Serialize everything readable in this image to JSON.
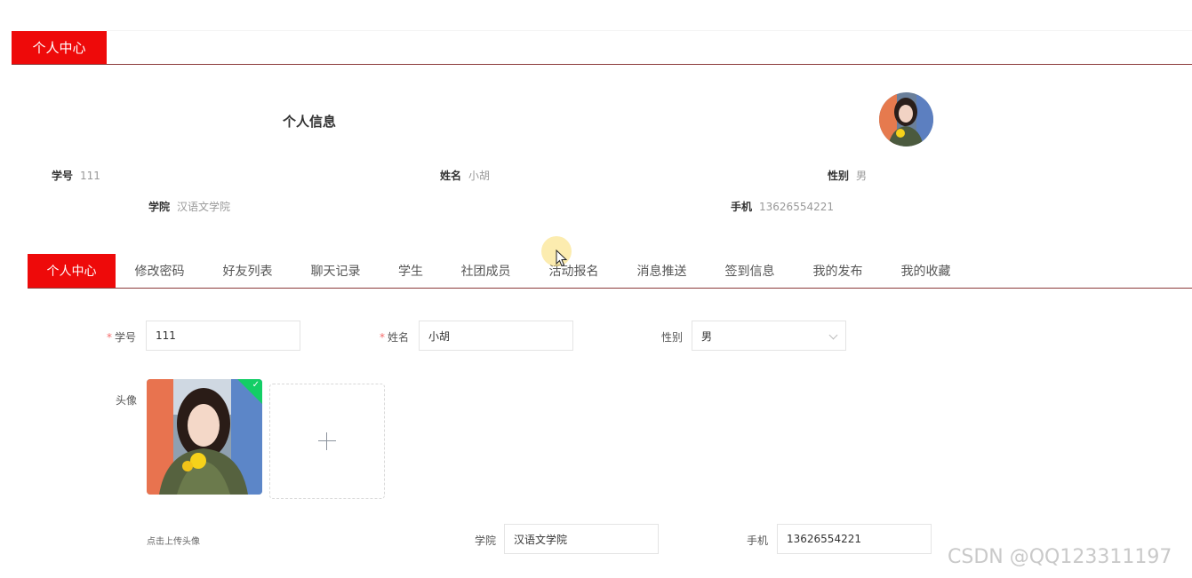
{
  "header": {
    "tab_label": "个人中心"
  },
  "profile": {
    "title": "个人信息",
    "student_id_label": "学号",
    "student_id": "111",
    "name_label": "姓名",
    "name": "小胡",
    "gender_label": "性别",
    "gender": "男",
    "college_label": "学院",
    "college": "汉语文学院",
    "phone_label": "手机",
    "phone": "13626554221"
  },
  "tabs": [
    {
      "label": "个人中心",
      "active": true
    },
    {
      "label": "修改密码"
    },
    {
      "label": "好友列表"
    },
    {
      "label": "聊天记录"
    },
    {
      "label": "学生"
    },
    {
      "label": "社团成员"
    },
    {
      "label": "活动报名"
    },
    {
      "label": "消息推送"
    },
    {
      "label": "签到信息"
    },
    {
      "label": "我的发布"
    },
    {
      "label": "我的收藏"
    }
  ],
  "form": {
    "student_id_label": "学号",
    "student_id_value": "111",
    "name_label": "姓名",
    "name_value": "小胡",
    "gender_label": "性别",
    "gender_value": "男",
    "avatar_label": "头像",
    "upload_hint": "点击上传头像",
    "college_label": "学院",
    "college_value": "汉语文学院",
    "phone_label": "手机",
    "phone_value": "13626554221",
    "required_mark": "*"
  },
  "watermark": "CSDN @QQ123311197",
  "colors": {
    "accent": "#ee0a0a",
    "divider": "#8c3a3a",
    "success_badge": "#13ce66"
  }
}
